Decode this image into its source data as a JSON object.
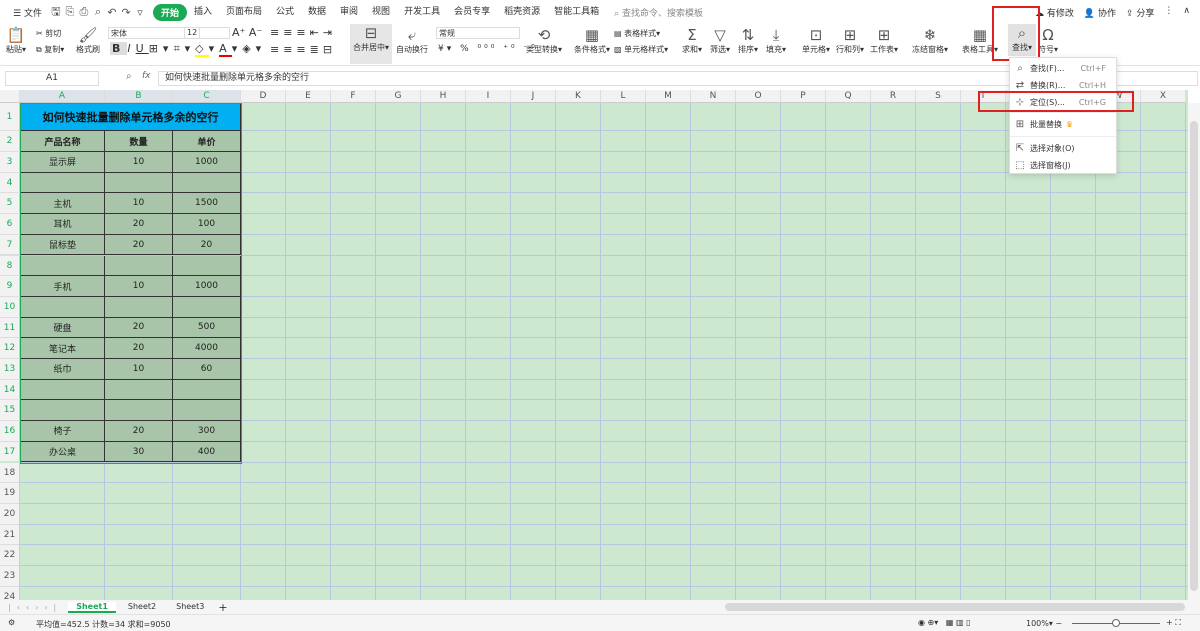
{
  "menubar": {
    "file": "文件",
    "items": [
      "开始",
      "插入",
      "页面布局",
      "公式",
      "数据",
      "审阅",
      "视图",
      "开发工具",
      "会员专享",
      "稻壳资源",
      "智能工具箱"
    ],
    "search_placeholder": "查找命令、搜索模板",
    "has_changes": "有修改",
    "collab": "协作",
    "share": "分享"
  },
  "ribbon": {
    "paste": "粘贴",
    "cut": "剪切",
    "copy": "复制",
    "format_painter": "格式刷",
    "font": "宋体",
    "font_size": "12",
    "merge": "合并居中",
    "wrap": "自动换行",
    "number_format": "常规",
    "type_convert": "类型转换",
    "cond_format": "条件格式",
    "table_style": "表格样式",
    "cell_style": "单元格样式",
    "sum": "求和",
    "filter": "筛选",
    "sort": "排序",
    "fill": "填充",
    "cell": "单元格",
    "rowcol": "行和列",
    "sheet": "工作表",
    "freeze": "冻结窗格",
    "table_tools": "表格工具",
    "find": "查找",
    "symbol": "符号"
  },
  "formula": {
    "cell_ref": "A1",
    "fx": "fx",
    "content": "如何快速批量删除单元格多余的空行"
  },
  "columns": [
    "A",
    "B",
    "C",
    "D",
    "E",
    "F",
    "G",
    "H",
    "I",
    "J",
    "K",
    "L",
    "M",
    "N",
    "O",
    "P",
    "Q",
    "R",
    "S",
    "T",
    "U",
    "V",
    "W",
    "X"
  ],
  "rows": [
    "1",
    "2",
    "3",
    "4",
    "5",
    "6",
    "7",
    "8",
    "9",
    "10",
    "11",
    "12",
    "13",
    "14",
    "15",
    "16",
    "17",
    "18",
    "19",
    "20",
    "21",
    "22",
    "23",
    "24"
  ],
  "table": {
    "title": "如何快速批量删除单元格多余的空行",
    "headers": [
      "产品名称",
      "数量",
      "单价"
    ],
    "rows": [
      [
        "显示屏",
        "10",
        "1000"
      ],
      [
        "",
        "",
        ""
      ],
      [
        "主机",
        "10",
        "1500"
      ],
      [
        "耳机",
        "20",
        "100"
      ],
      [
        "鼠标垫",
        "20",
        "20"
      ],
      [
        "",
        "",
        ""
      ],
      [
        "手机",
        "10",
        "1000"
      ],
      [
        "",
        "",
        ""
      ],
      [
        "硬盘",
        "20",
        "500"
      ],
      [
        "笔记本",
        "20",
        "4000"
      ],
      [
        "纸巾",
        "10",
        "60"
      ],
      [
        "",
        "",
        ""
      ],
      [
        "",
        "",
        ""
      ],
      [
        "椅子",
        "20",
        "300"
      ],
      [
        "办公桌",
        "30",
        "400"
      ]
    ]
  },
  "find_menu": [
    {
      "label": "查找(F)...",
      "shortcut": "Ctrl+F",
      "icon": "search-icon"
    },
    {
      "label": "替换(R)...",
      "shortcut": "Ctrl+H",
      "icon": "replace-icon"
    },
    {
      "label": "定位(S)...",
      "shortcut": "Ctrl+G",
      "icon": "locate-icon"
    },
    {
      "label": "批量替换",
      "shortcut": "",
      "icon": "batch-replace-icon"
    },
    {
      "label": "选择对象(O)",
      "shortcut": "",
      "icon": "pointer-icon"
    },
    {
      "label": "选择窗格(J)",
      "shortcut": "",
      "icon": "pane-icon"
    }
  ],
  "sheets": [
    "Sheet1",
    "Sheet2",
    "Sheet3"
  ],
  "status": {
    "text": "平均值=452.5  计数=34  求和=9050",
    "zoom": "100%"
  },
  "colors": {
    "accent": "#1aaa55",
    "title_fill": "#00b0f0",
    "table_fill": "#a8c5a9",
    "grid_bg": "#cce8cf",
    "highlight": "#e02020"
  }
}
